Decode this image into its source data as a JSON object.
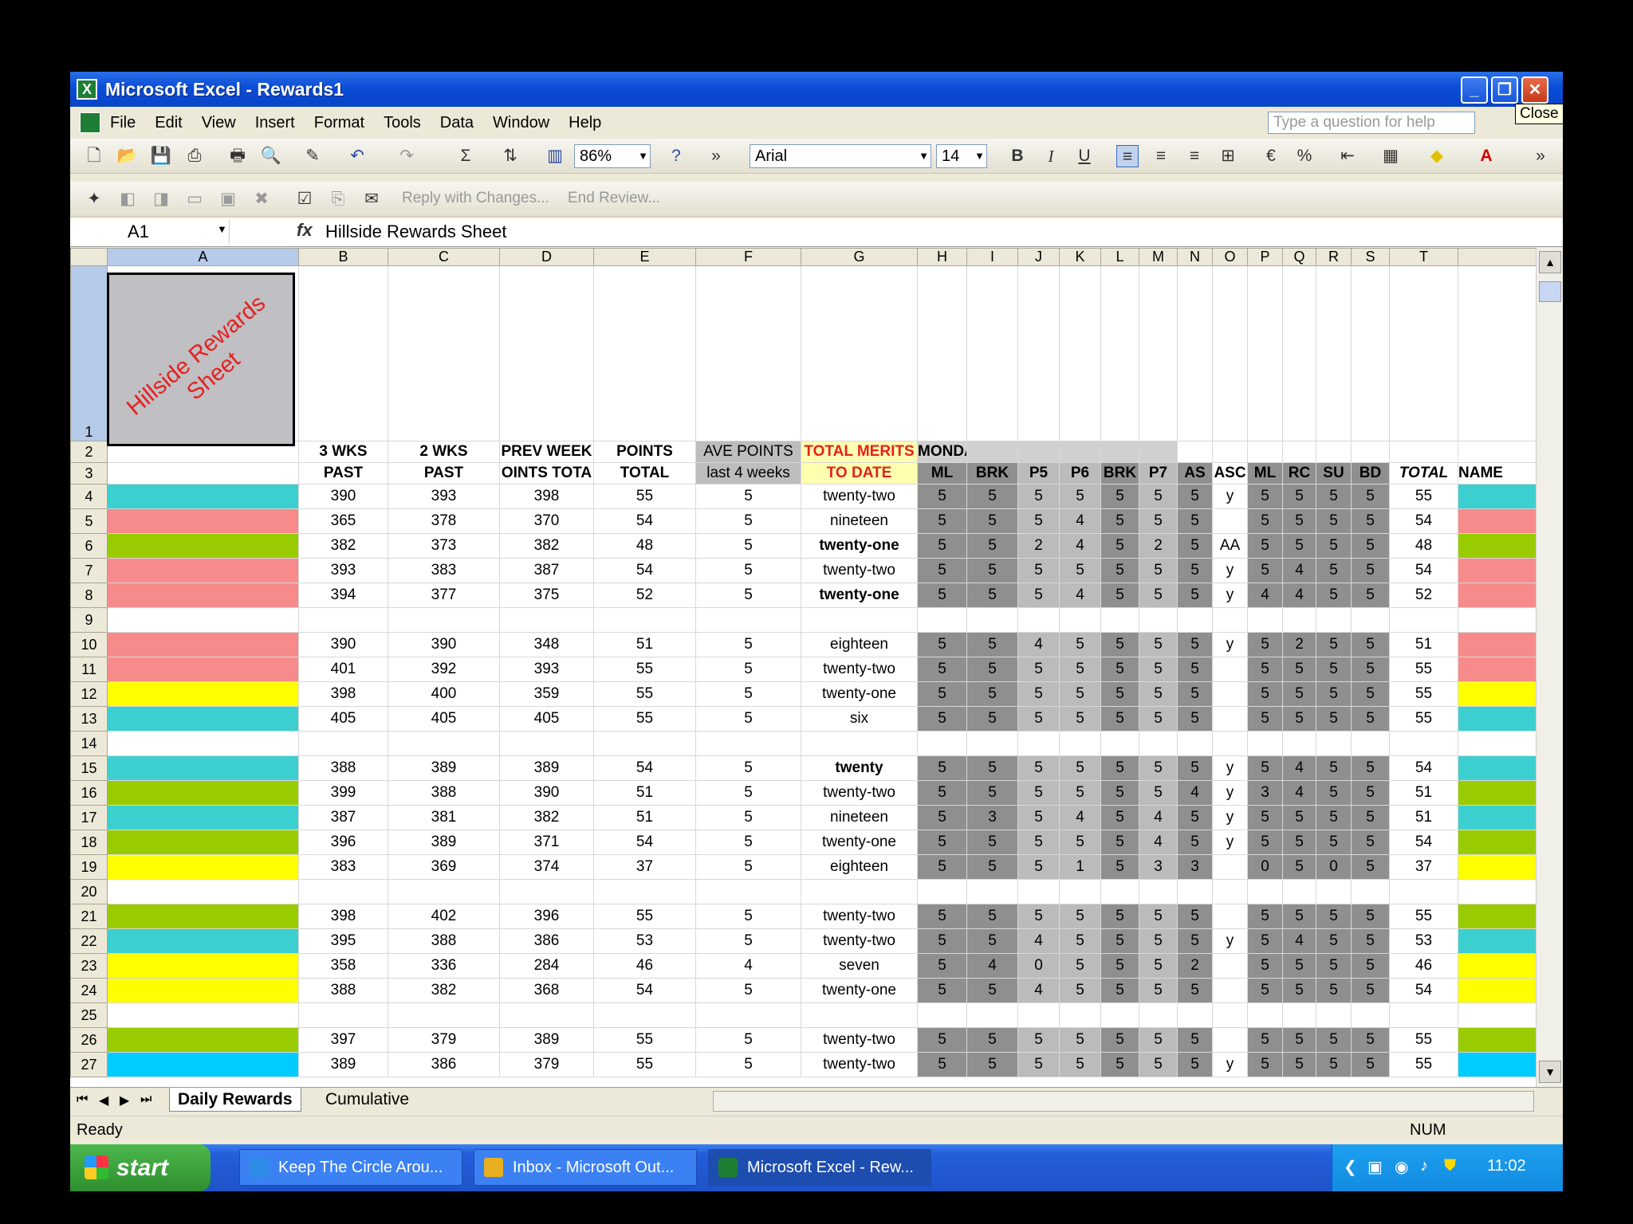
{
  "window": {
    "title": "Microsoft Excel - Rewards1",
    "close_tooltip": "Close"
  },
  "menu": [
    "File",
    "Edit",
    "View",
    "Insert",
    "Format",
    "Tools",
    "Data",
    "Window",
    "Help"
  ],
  "help_placeholder": "Type a question for help",
  "toolbar": {
    "zoom": "86%",
    "font": "Arial",
    "font_size": "14"
  },
  "review_toolbar": {
    "reply": "Reply with Changes...",
    "end": "End Review..."
  },
  "formula_bar": {
    "name_box": "A1",
    "fx": "fx",
    "content": "Hillside Rewards Sheet"
  },
  "title_cell": "Hillside Rewards Sheet",
  "columns": [
    "A",
    "B",
    "C",
    "D",
    "E",
    "F",
    "G",
    "H",
    "I",
    "J",
    "K",
    "L",
    "M",
    "N",
    "O",
    "P",
    "Q",
    "R",
    "S",
    "T",
    ""
  ],
  "header_row2": [
    "",
    "3 WKS",
    "2 WKS",
    "PREV WEEK",
    "POINTS",
    "AVE POINTS",
    "TOTAL MERITS",
    "MONDAY",
    "",
    "",
    "",
    "",
    "",
    "",
    "",
    "",
    "",
    "",
    "",
    "",
    ""
  ],
  "header_row3": [
    "",
    "PAST",
    "PAST",
    "OINTS TOTA",
    "TOTAL",
    "last 4 weeks",
    "TO DATE",
    "ML",
    "BRK",
    "P5",
    "P6",
    "BRK",
    "P7",
    "AS",
    "ASC",
    "ML",
    "RC",
    "SU",
    "BD",
    "TOTAL",
    "NAME"
  ],
  "rows": [
    {
      "n": "4",
      "color": "#3CCFCF",
      "v": [
        "390",
        "393",
        "398",
        "55",
        "5",
        "twenty-two",
        "5",
        "5",
        "5",
        "5",
        "5",
        "5",
        "5",
        "y",
        "5",
        "5",
        "5",
        "5",
        "55"
      ]
    },
    {
      "n": "5",
      "color": "#F78A8A",
      "v": [
        "365",
        "378",
        "370",
        "54",
        "5",
        "nineteen",
        "5",
        "5",
        "5",
        "4",
        "5",
        "5",
        "5",
        "",
        "5",
        "5",
        "5",
        "5",
        "54"
      ]
    },
    {
      "n": "6",
      "color": "#99CC00",
      "v": [
        "382",
        "373",
        "382",
        "48",
        "5",
        "twenty-one",
        "5",
        "5",
        "2",
        "4",
        "5",
        "2",
        "5",
        "AA",
        "5",
        "5",
        "5",
        "5",
        "48"
      ],
      "bold": true
    },
    {
      "n": "7",
      "color": "#F78A8A",
      "v": [
        "393",
        "383",
        "387",
        "54",
        "5",
        "twenty-two",
        "5",
        "5",
        "5",
        "5",
        "5",
        "5",
        "5",
        "y",
        "5",
        "4",
        "5",
        "5",
        "54"
      ]
    },
    {
      "n": "8",
      "color": "#F78A8A",
      "v": [
        "394",
        "377",
        "375",
        "52",
        "5",
        "twenty-one",
        "5",
        "5",
        "5",
        "4",
        "5",
        "5",
        "5",
        "y",
        "4",
        "4",
        "5",
        "5",
        "52"
      ],
      "bold": true
    },
    {
      "n": "9",
      "color": "",
      "v": [
        "",
        "",
        "",
        "",
        "",
        "",
        "",
        "",
        "",
        "",
        "",
        "",
        "",
        "",
        "",
        "",
        "",
        "",
        ""
      ],
      "empty": true
    },
    {
      "n": "10",
      "color": "#F78A8A",
      "v": [
        "390",
        "390",
        "348",
        "51",
        "5",
        "eighteen",
        "5",
        "5",
        "4",
        "5",
        "5",
        "5",
        "5",
        "y",
        "5",
        "2",
        "5",
        "5",
        "51"
      ]
    },
    {
      "n": "11",
      "color": "#F78A8A",
      "v": [
        "401",
        "392",
        "393",
        "55",
        "5",
        "twenty-two",
        "5",
        "5",
        "5",
        "5",
        "5",
        "5",
        "5",
        "",
        "5",
        "5",
        "5",
        "5",
        "55"
      ]
    },
    {
      "n": "12",
      "color": "#FFFF00",
      "v": [
        "398",
        "400",
        "359",
        "55",
        "5",
        "twenty-one",
        "5",
        "5",
        "5",
        "5",
        "5",
        "5",
        "5",
        "",
        "5",
        "5",
        "5",
        "5",
        "55"
      ]
    },
    {
      "n": "13",
      "color": "#3CCFCF",
      "v": [
        "405",
        "405",
        "405",
        "55",
        "5",
        "six",
        "5",
        "5",
        "5",
        "5",
        "5",
        "5",
        "5",
        "",
        "5",
        "5",
        "5",
        "5",
        "55"
      ]
    },
    {
      "n": "14",
      "color": "",
      "v": [
        "",
        "",
        "",
        "",
        "",
        "",
        "",
        "",
        "",
        "",
        "",
        "",
        "",
        "",
        "",
        "",
        "",
        "",
        ""
      ],
      "empty": true
    },
    {
      "n": "15",
      "color": "#3CCFCF",
      "v": [
        "388",
        "389",
        "389",
        "54",
        "5",
        "twenty",
        "5",
        "5",
        "5",
        "5",
        "5",
        "5",
        "5",
        "y",
        "5",
        "4",
        "5",
        "5",
        "54"
      ],
      "bold": true
    },
    {
      "n": "16",
      "color": "#99CC00",
      "v": [
        "399",
        "388",
        "390",
        "51",
        "5",
        "twenty-two",
        "5",
        "5",
        "5",
        "5",
        "5",
        "5",
        "4",
        "y",
        "3",
        "4",
        "5",
        "5",
        "51"
      ]
    },
    {
      "n": "17",
      "color": "#3CCFCF",
      "v": [
        "387",
        "381",
        "382",
        "51",
        "5",
        "nineteen",
        "5",
        "3",
        "5",
        "4",
        "5",
        "4",
        "5",
        "y",
        "5",
        "5",
        "5",
        "5",
        "51"
      ]
    },
    {
      "n": "18",
      "color": "#99CC00",
      "v": [
        "396",
        "389",
        "371",
        "54",
        "5",
        "twenty-one",
        "5",
        "5",
        "5",
        "5",
        "5",
        "4",
        "5",
        "y",
        "5",
        "5",
        "5",
        "5",
        "54"
      ]
    },
    {
      "n": "19",
      "color": "#FFFF00",
      "v": [
        "383",
        "369",
        "374",
        "37",
        "5",
        "eighteen",
        "5",
        "5",
        "5",
        "1",
        "5",
        "3",
        "3",
        "",
        "0",
        "5",
        "0",
        "5",
        "37"
      ]
    },
    {
      "n": "20",
      "color": "",
      "v": [
        "",
        "",
        "",
        "",
        "",
        "",
        "",
        "",
        "",
        "",
        "",
        "",
        "",
        "",
        "",
        "",
        "",
        "",
        ""
      ],
      "empty": true
    },
    {
      "n": "21",
      "color": "#99CC00",
      "v": [
        "398",
        "402",
        "396",
        "55",
        "5",
        "twenty-two",
        "5",
        "5",
        "5",
        "5",
        "5",
        "5",
        "5",
        "",
        "5",
        "5",
        "5",
        "5",
        "55"
      ]
    },
    {
      "n": "22",
      "color": "#3CCFCF",
      "v": [
        "395",
        "388",
        "386",
        "53",
        "5",
        "twenty-two",
        "5",
        "5",
        "4",
        "5",
        "5",
        "5",
        "5",
        "y",
        "5",
        "4",
        "5",
        "5",
        "53"
      ]
    },
    {
      "n": "23",
      "color": "#FFFF00",
      "v": [
        "358",
        "336",
        "284",
        "46",
        "4",
        "seven",
        "5",
        "4",
        "0",
        "5",
        "5",
        "5",
        "2",
        "",
        "5",
        "5",
        "5",
        "5",
        "46"
      ]
    },
    {
      "n": "24",
      "color": "#FFFF00",
      "v": [
        "388",
        "382",
        "368",
        "54",
        "5",
        "twenty-one",
        "5",
        "5",
        "4",
        "5",
        "5",
        "5",
        "5",
        "",
        "5",
        "5",
        "5",
        "5",
        "54"
      ]
    },
    {
      "n": "25",
      "color": "",
      "v": [
        "",
        "",
        "",
        "",
        "",
        "",
        "",
        "",
        "",
        "",
        "",
        "",
        "",
        "",
        "",
        "",
        "",
        "",
        ""
      ],
      "empty": true
    },
    {
      "n": "26",
      "color": "#99CC00",
      "v": [
        "397",
        "379",
        "389",
        "55",
        "5",
        "twenty-two",
        "5",
        "5",
        "5",
        "5",
        "5",
        "5",
        "5",
        "",
        "5",
        "5",
        "5",
        "5",
        "55"
      ]
    },
    {
      "n": "27",
      "color": "#00CCFF",
      "v": [
        "389",
        "386",
        "379",
        "55",
        "5",
        "twenty-two",
        "5",
        "5",
        "5",
        "5",
        "5",
        "5",
        "5",
        "y",
        "5",
        "5",
        "5",
        "5",
        "55"
      ]
    }
  ],
  "sheet_tabs": [
    "Daily Rewards",
    "Cumulative"
  ],
  "status": {
    "left": "Ready",
    "right": "NUM"
  },
  "taskbar": {
    "start": "start",
    "tasks": [
      "Keep The Circle Arou...",
      "Inbox - Microsoft Out...",
      "Microsoft Excel - Rew..."
    ],
    "clock": "11:02"
  },
  "colors": {
    "cyan": "#3CCFCF",
    "pink": "#F78A8A",
    "green": "#99CC00",
    "yellow": "#FFFF00",
    "titlebar": "#0A4CD6"
  }
}
